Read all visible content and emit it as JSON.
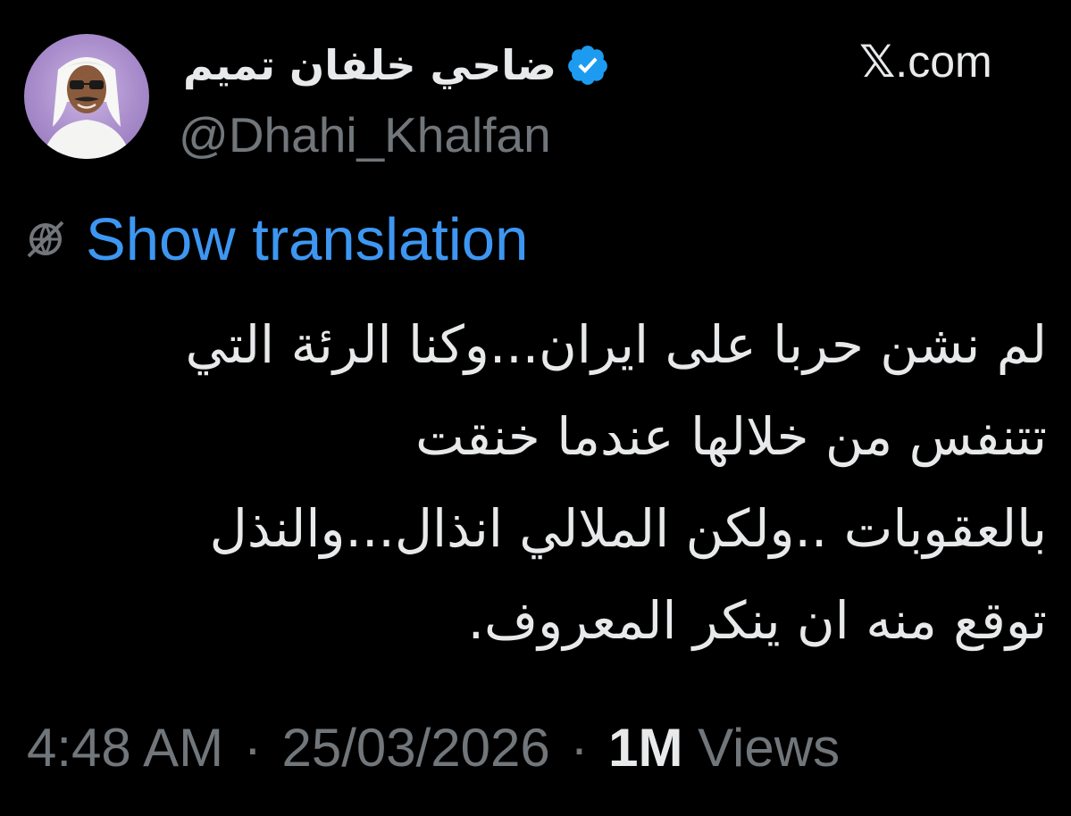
{
  "author": {
    "name": "ضاحي خلفان تميم",
    "handle": "@Dhahi_Khalfan",
    "verified": true
  },
  "site": {
    "x_glyph": "𝕏",
    "domain": ".com"
  },
  "translate": {
    "label": "Show translation"
  },
  "tweet": {
    "lines": [
      "لم نشن حربا على ايران...وكنا الرئة التي",
      "تتنفس من خلالها عندما خنقت",
      "بالعقوبات ..ولكن الملالي انذال...والنذل",
      "توقع منه ان ينكر المعروف."
    ]
  },
  "meta": {
    "time": "4:48 AM",
    "separator": "·",
    "date": "25/03/2026",
    "views_count": "1M",
    "views_label": "Views"
  },
  "colors": {
    "background": "#000000",
    "text": "#e7e9ea",
    "muted": "#71767b",
    "link": "#3d97f2",
    "verified": "#1d9bf0"
  }
}
